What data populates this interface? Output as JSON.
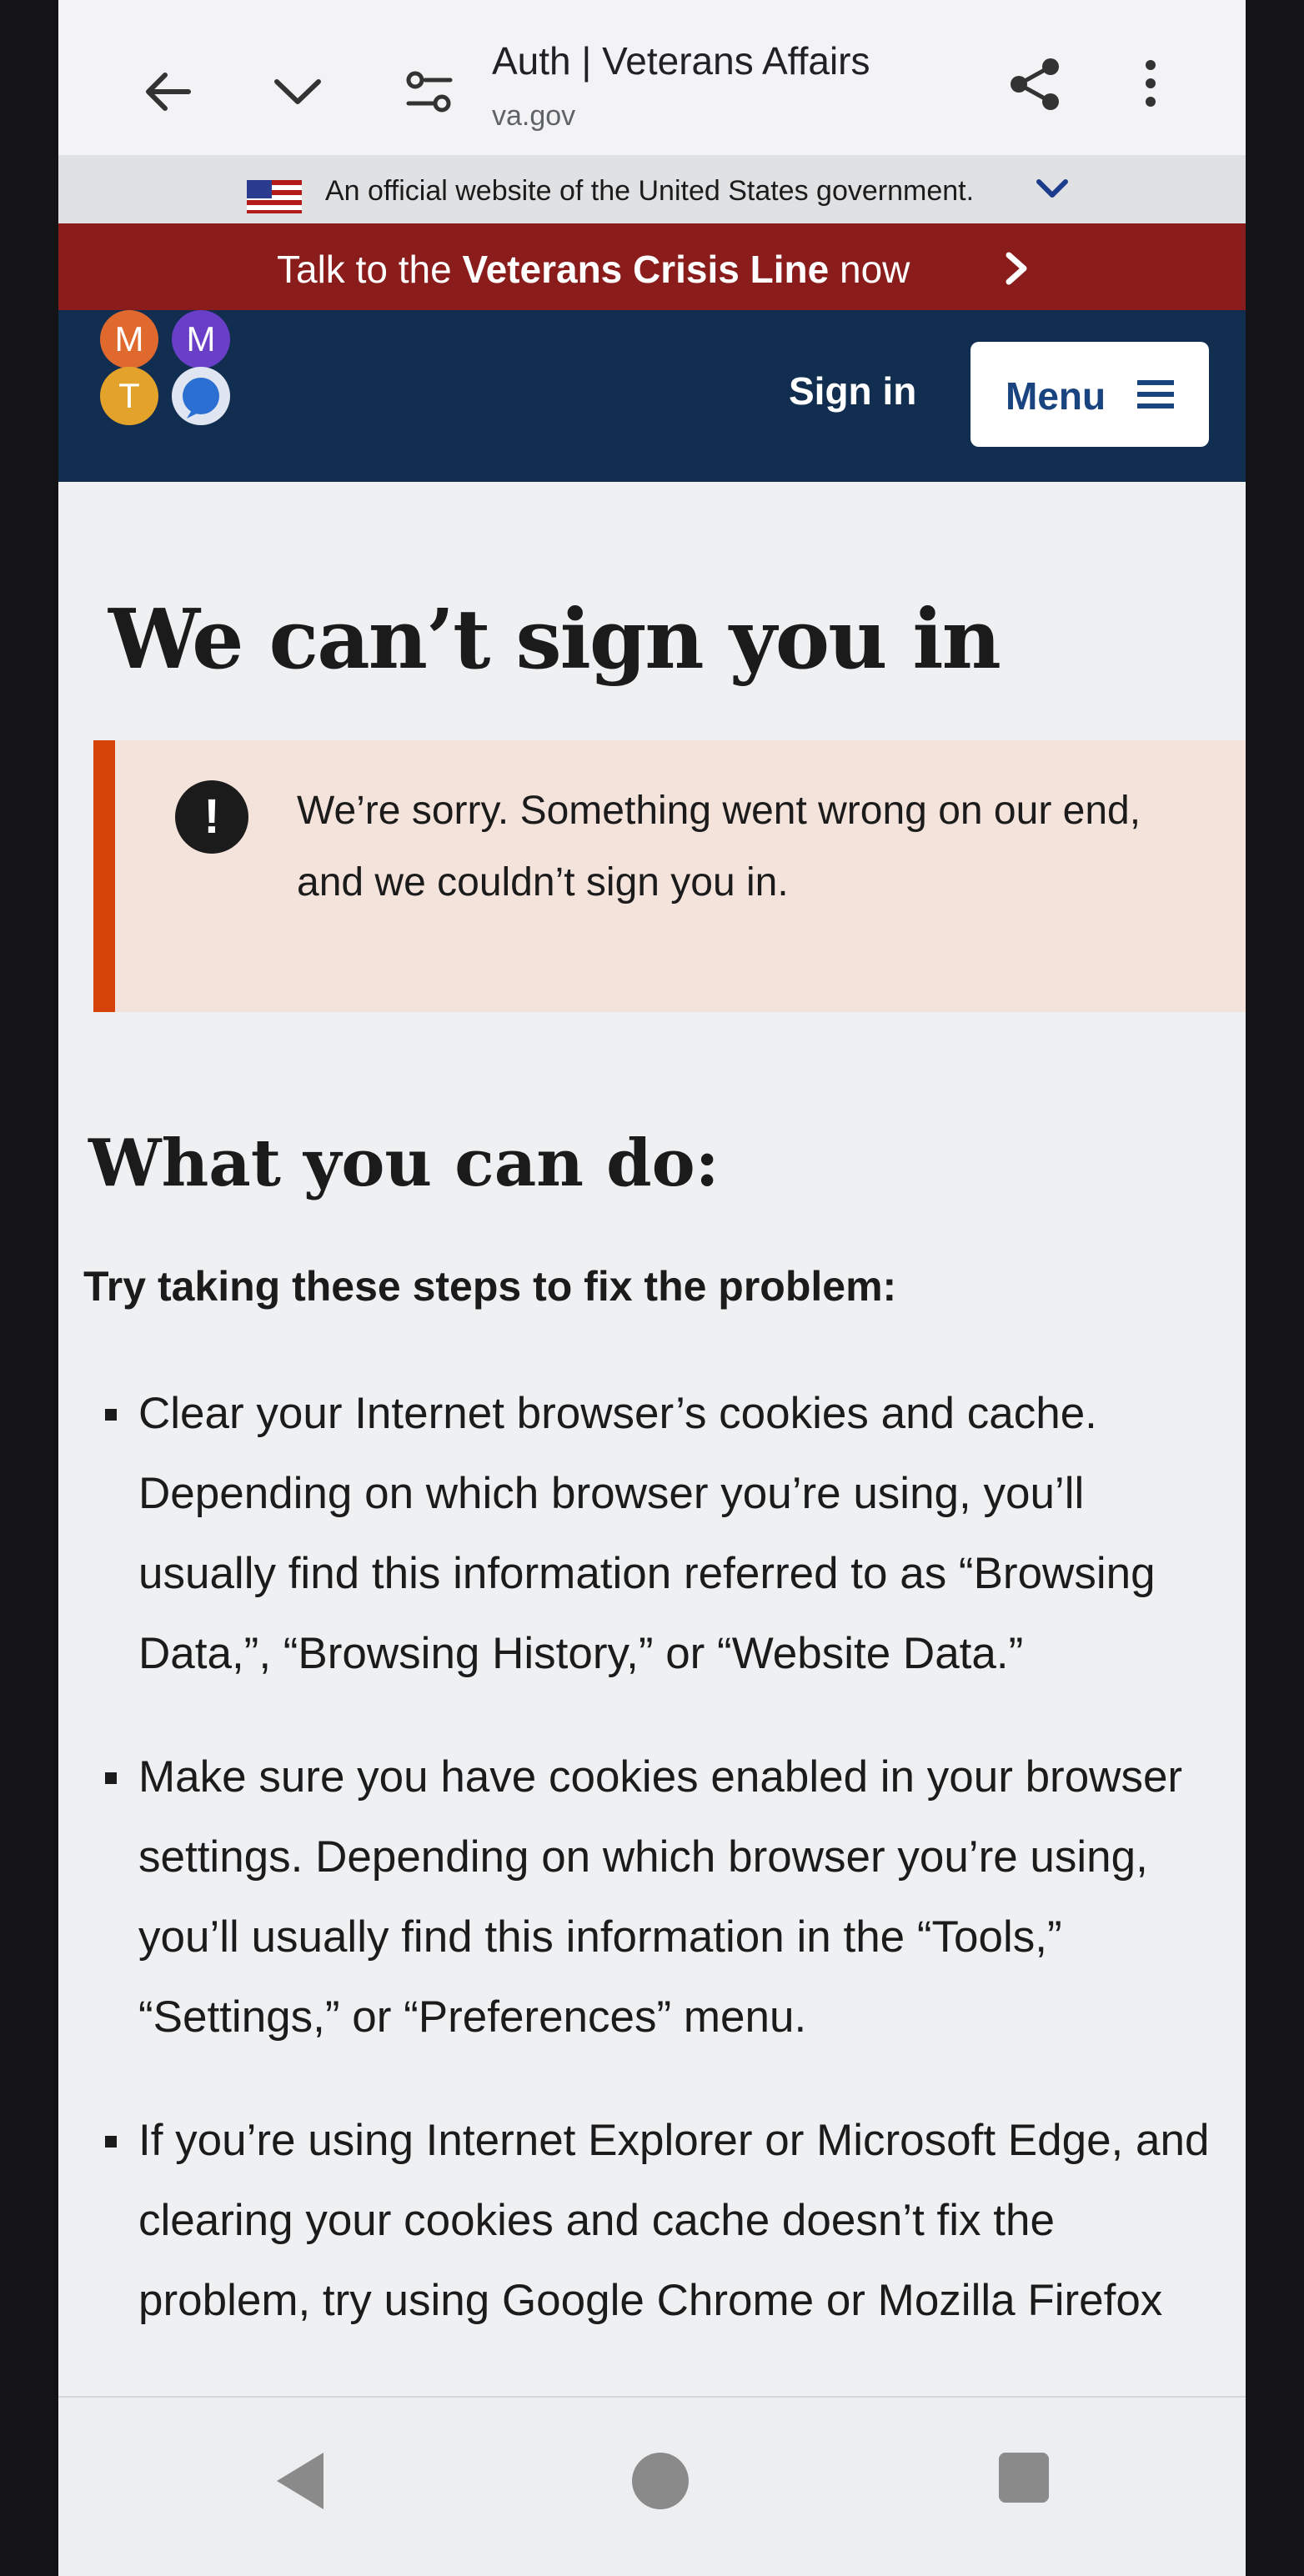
{
  "browser": {
    "title": "Auth | Veterans Affairs",
    "url": "va.gov",
    "icons": [
      "back-arrow-icon",
      "chevron-down-icon",
      "site-settings-icon",
      "share-icon",
      "more-vert-icon"
    ]
  },
  "gov_banner": {
    "text": "An official website of the United States government.",
    "chevron": "⌄"
  },
  "crisis_line": {
    "prefix": "Talk to the ",
    "emphasis": "Veterans Crisis Line",
    "suffix": " now",
    "arrow": "›"
  },
  "header": {
    "avatars": [
      {
        "letter": "M",
        "color": "#e06a2e"
      },
      {
        "letter": "M",
        "color": "#6a3fc8"
      },
      {
        "letter": "T",
        "color": "#e3a32a"
      }
    ],
    "sign_in": "Sign in",
    "menu": "Menu"
  },
  "main": {
    "title": "We can’t sign you in",
    "alert": {
      "icon": "!",
      "text": "We’re sorry. Something went wrong on our end, and we couldn’t sign you in."
    },
    "subtitle": "What you can do:",
    "steps_intro": "Try taking these steps to fix the problem:",
    "steps": [
      "Clear your Internet browser’s cookies and cache. Depending on which browser you’re using, you’ll usually find this information referred to as “Browsing Data,”, “Browsing History,” or “Website Data.”",
      "Make sure you have cookies enabled in your browser settings. Depending on which browser you’re using, you’ll usually find this information in the “Tools,” “Settings,” or “Preferences” menu.",
      "If you’re using Internet Explorer or Microsoft Edge, and clearing your cookies and cache doesn’t fix the problem, try using Google Chrome or Mozilla Firefox"
    ]
  },
  "colors": {
    "crisis_red": "#8a1c1c",
    "header_navy": "#112e51",
    "alert_bg": "#f4e3db",
    "alert_border": "#d54309",
    "link_blue": "#1a4480"
  }
}
